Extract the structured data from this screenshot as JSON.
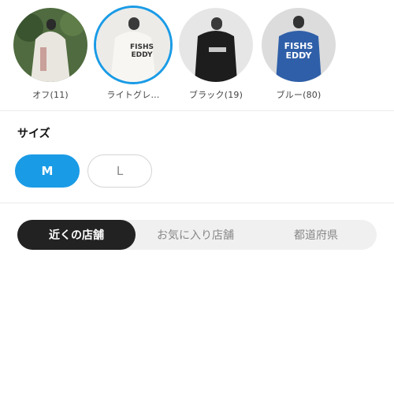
{
  "colors": {
    "items": [
      {
        "label": "オフ(11)",
        "selected": false
      },
      {
        "label": "ライトグレ…",
        "selected": true
      },
      {
        "label": "ブラック(19)",
        "selected": false
      },
      {
        "label": "ブルー(80)",
        "selected": false
      }
    ],
    "accent": "#1a9be6"
  },
  "size": {
    "title": "サイズ",
    "options": [
      "M",
      "L"
    ],
    "selected": "M"
  },
  "store_tabs": {
    "items": [
      "近くの店舗",
      "お気に入り店舗",
      "都道府県"
    ],
    "active": "近くの店舗"
  }
}
